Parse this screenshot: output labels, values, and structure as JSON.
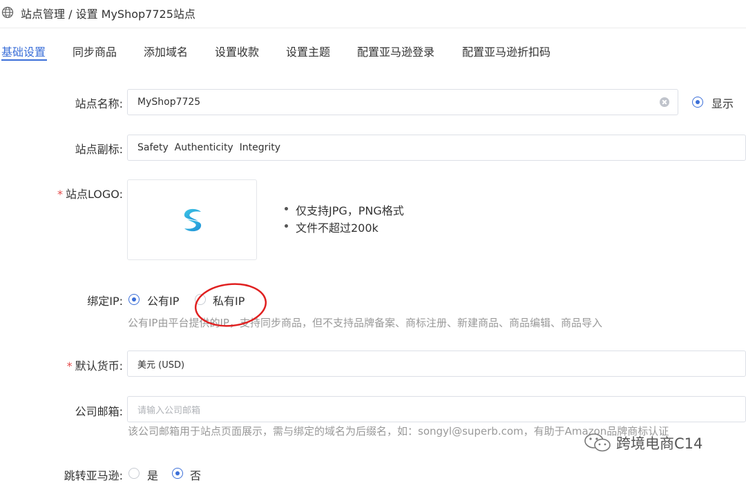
{
  "header": {
    "breadcrumb": "站点管理 / 设置 MyShop7725站点"
  },
  "tabs": [
    {
      "label": "基础设置",
      "active": true
    },
    {
      "label": "同步商品"
    },
    {
      "label": "添加域名"
    },
    {
      "label": "设置收款"
    },
    {
      "label": "设置主题"
    },
    {
      "label": "配置亚马逊登录"
    },
    {
      "label": "配置亚马逊折扣码"
    }
  ],
  "form": {
    "site_name": {
      "label": "站点名称:",
      "value": "MyShop7725",
      "display_option": "显示"
    },
    "site_subtitle": {
      "label": "站点副标:",
      "value": "Safety  Authenticity  Integrity"
    },
    "site_logo": {
      "required_mark": "*",
      "label": "站点LOGO:",
      "tips": [
        "仅支持JPG，PNG格式",
        "文件不超过200k"
      ]
    },
    "bind_ip": {
      "label": "绑定IP:",
      "options": [
        "公有IP",
        "私有IP"
      ],
      "selected": "公有IP",
      "help": "公有IP由平台提供的IP，支持同步商品，但不支持品牌备案、商标注册、新建商品、商品编辑、商品导入"
    },
    "currency": {
      "required_mark": "*",
      "label": "默认货币:",
      "value": "美元 (USD)"
    },
    "company_email": {
      "label": "公司邮箱:",
      "placeholder": "请输入公司邮箱",
      "help": "该公司邮箱用于站点页面展示，需与绑定的域名为后缀名，如：songyl@superb.com，有助于Amazon品牌商标认证"
    },
    "redirect_amazon": {
      "label": "跳转亚马逊:",
      "options": [
        "是",
        "否"
      ],
      "selected": "否"
    }
  },
  "watermark": {
    "text": "跨境电商C14"
  },
  "colors": {
    "accent": "#3b6fd8",
    "required": "#e44b4b",
    "annotation": "#e02020"
  }
}
